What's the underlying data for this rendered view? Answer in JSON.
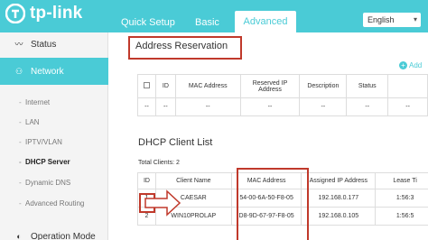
{
  "header": {
    "brand": "tp-link",
    "tabs": [
      {
        "label": "Quick Setup"
      },
      {
        "label": "Basic"
      },
      {
        "label": "Advanced"
      }
    ],
    "language": "English"
  },
  "sidebar": {
    "status": "Status",
    "network": "Network",
    "sub_items": [
      "Internet",
      "LAN",
      "IPTV/VLAN",
      "DHCP Server",
      "Dynamic DNS",
      "Advanced Routing"
    ],
    "operation_mode": "Operation Mode"
  },
  "address_reservation": {
    "title": "Address Reservation",
    "add_label": "Add",
    "columns": [
      "ID",
      "MAC Address",
      "Reserved IP Address",
      "Description",
      "Status"
    ],
    "empty_cell": "--"
  },
  "dhcp_client_list": {
    "title": "DHCP Client List",
    "total": "Total Clients: 2",
    "columns": [
      "ID",
      "Client Name",
      "MAC Address",
      "Assigned IP Address",
      "Lease Ti"
    ],
    "rows": [
      {
        "id": "1",
        "name": "CAESAR",
        "mac": "54-00-6A-50-F8-05",
        "ip": "192.168.0.177",
        "lease": "1:56:3"
      },
      {
        "id": "2",
        "name": "WIN10PROLAP",
        "mac": "D8-9D-67-97-F8-05",
        "ip": "192.168.0.105",
        "lease": "1:56:5"
      }
    ]
  },
  "colors": {
    "accent": "#4acbd6",
    "highlight": "#c0392b"
  }
}
